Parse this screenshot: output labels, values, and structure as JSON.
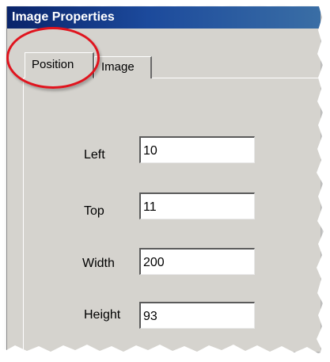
{
  "window": {
    "title": "Image Properties"
  },
  "tabs": [
    {
      "label": "Position",
      "active": true
    },
    {
      "label": "Image",
      "active": false
    }
  ],
  "fields": {
    "left": {
      "label": "Left",
      "value": "10"
    },
    "top": {
      "label": "Top",
      "value": "11"
    },
    "width": {
      "label": "Width",
      "value": "200"
    },
    "height": {
      "label": "Height",
      "value": "93"
    }
  },
  "colors": {
    "titlebar_start": "#0a246a",
    "titlebar_end": "#3a6ea5",
    "dialog_background": "#d5d3ce",
    "highlight_circle": "#e0141e"
  },
  "annotation": {
    "highlight": "red-circle-around-position-tab"
  }
}
